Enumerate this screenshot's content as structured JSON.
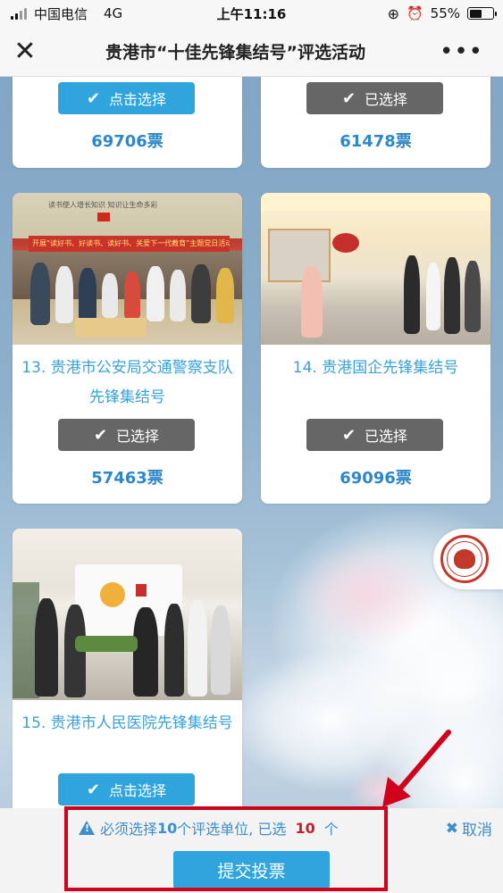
{
  "status_bar": {
    "carrier": "中国电信",
    "network": "4G",
    "time": "上午11:16",
    "battery": "55%",
    "battery_level": 0.55
  },
  "nav": {
    "title": "贵港市“十佳先锋集结号”评选活动",
    "more": "•••"
  },
  "cards_top": [
    {
      "button_label": "点击选择",
      "button_state": "select",
      "votes": "69706票"
    },
    {
      "button_label": "已选择",
      "button_state": "selected",
      "votes": "61478票"
    }
  ],
  "cards": [
    {
      "name": "13. 贵港市公安局交通警察支队先锋集结号",
      "button_label": "已选择",
      "button_state": "selected",
      "votes": "57463票",
      "photo_banner": "开展“读好书、好读书、读好书、关爱下一代教育”主题党日活动",
      "photo_top_text": "读书使人增长知识  知识让生命多彩"
    },
    {
      "name": "14. 贵港国企先锋集结号",
      "button_label": "已选择",
      "button_state": "selected",
      "votes": "69096票"
    },
    {
      "name": "15. 贵港市人民医院先锋集结号",
      "button_label": "点击选择",
      "button_state": "select"
    }
  ],
  "bottom": {
    "tip_prefix": "必须选择",
    "tip_required": "10",
    "tip_middle": "个评选单位, 已选",
    "tip_selected": "10",
    "tip_suffix": "个",
    "cancel_label": "取消",
    "submit_label": "提交投票"
  },
  "colors": {
    "accent": "#2fa4dd",
    "selected_button": "#666666",
    "link_text": "#3aa1d9",
    "votes_text": "#2f86c9",
    "annotation_red": "#d0021b"
  }
}
